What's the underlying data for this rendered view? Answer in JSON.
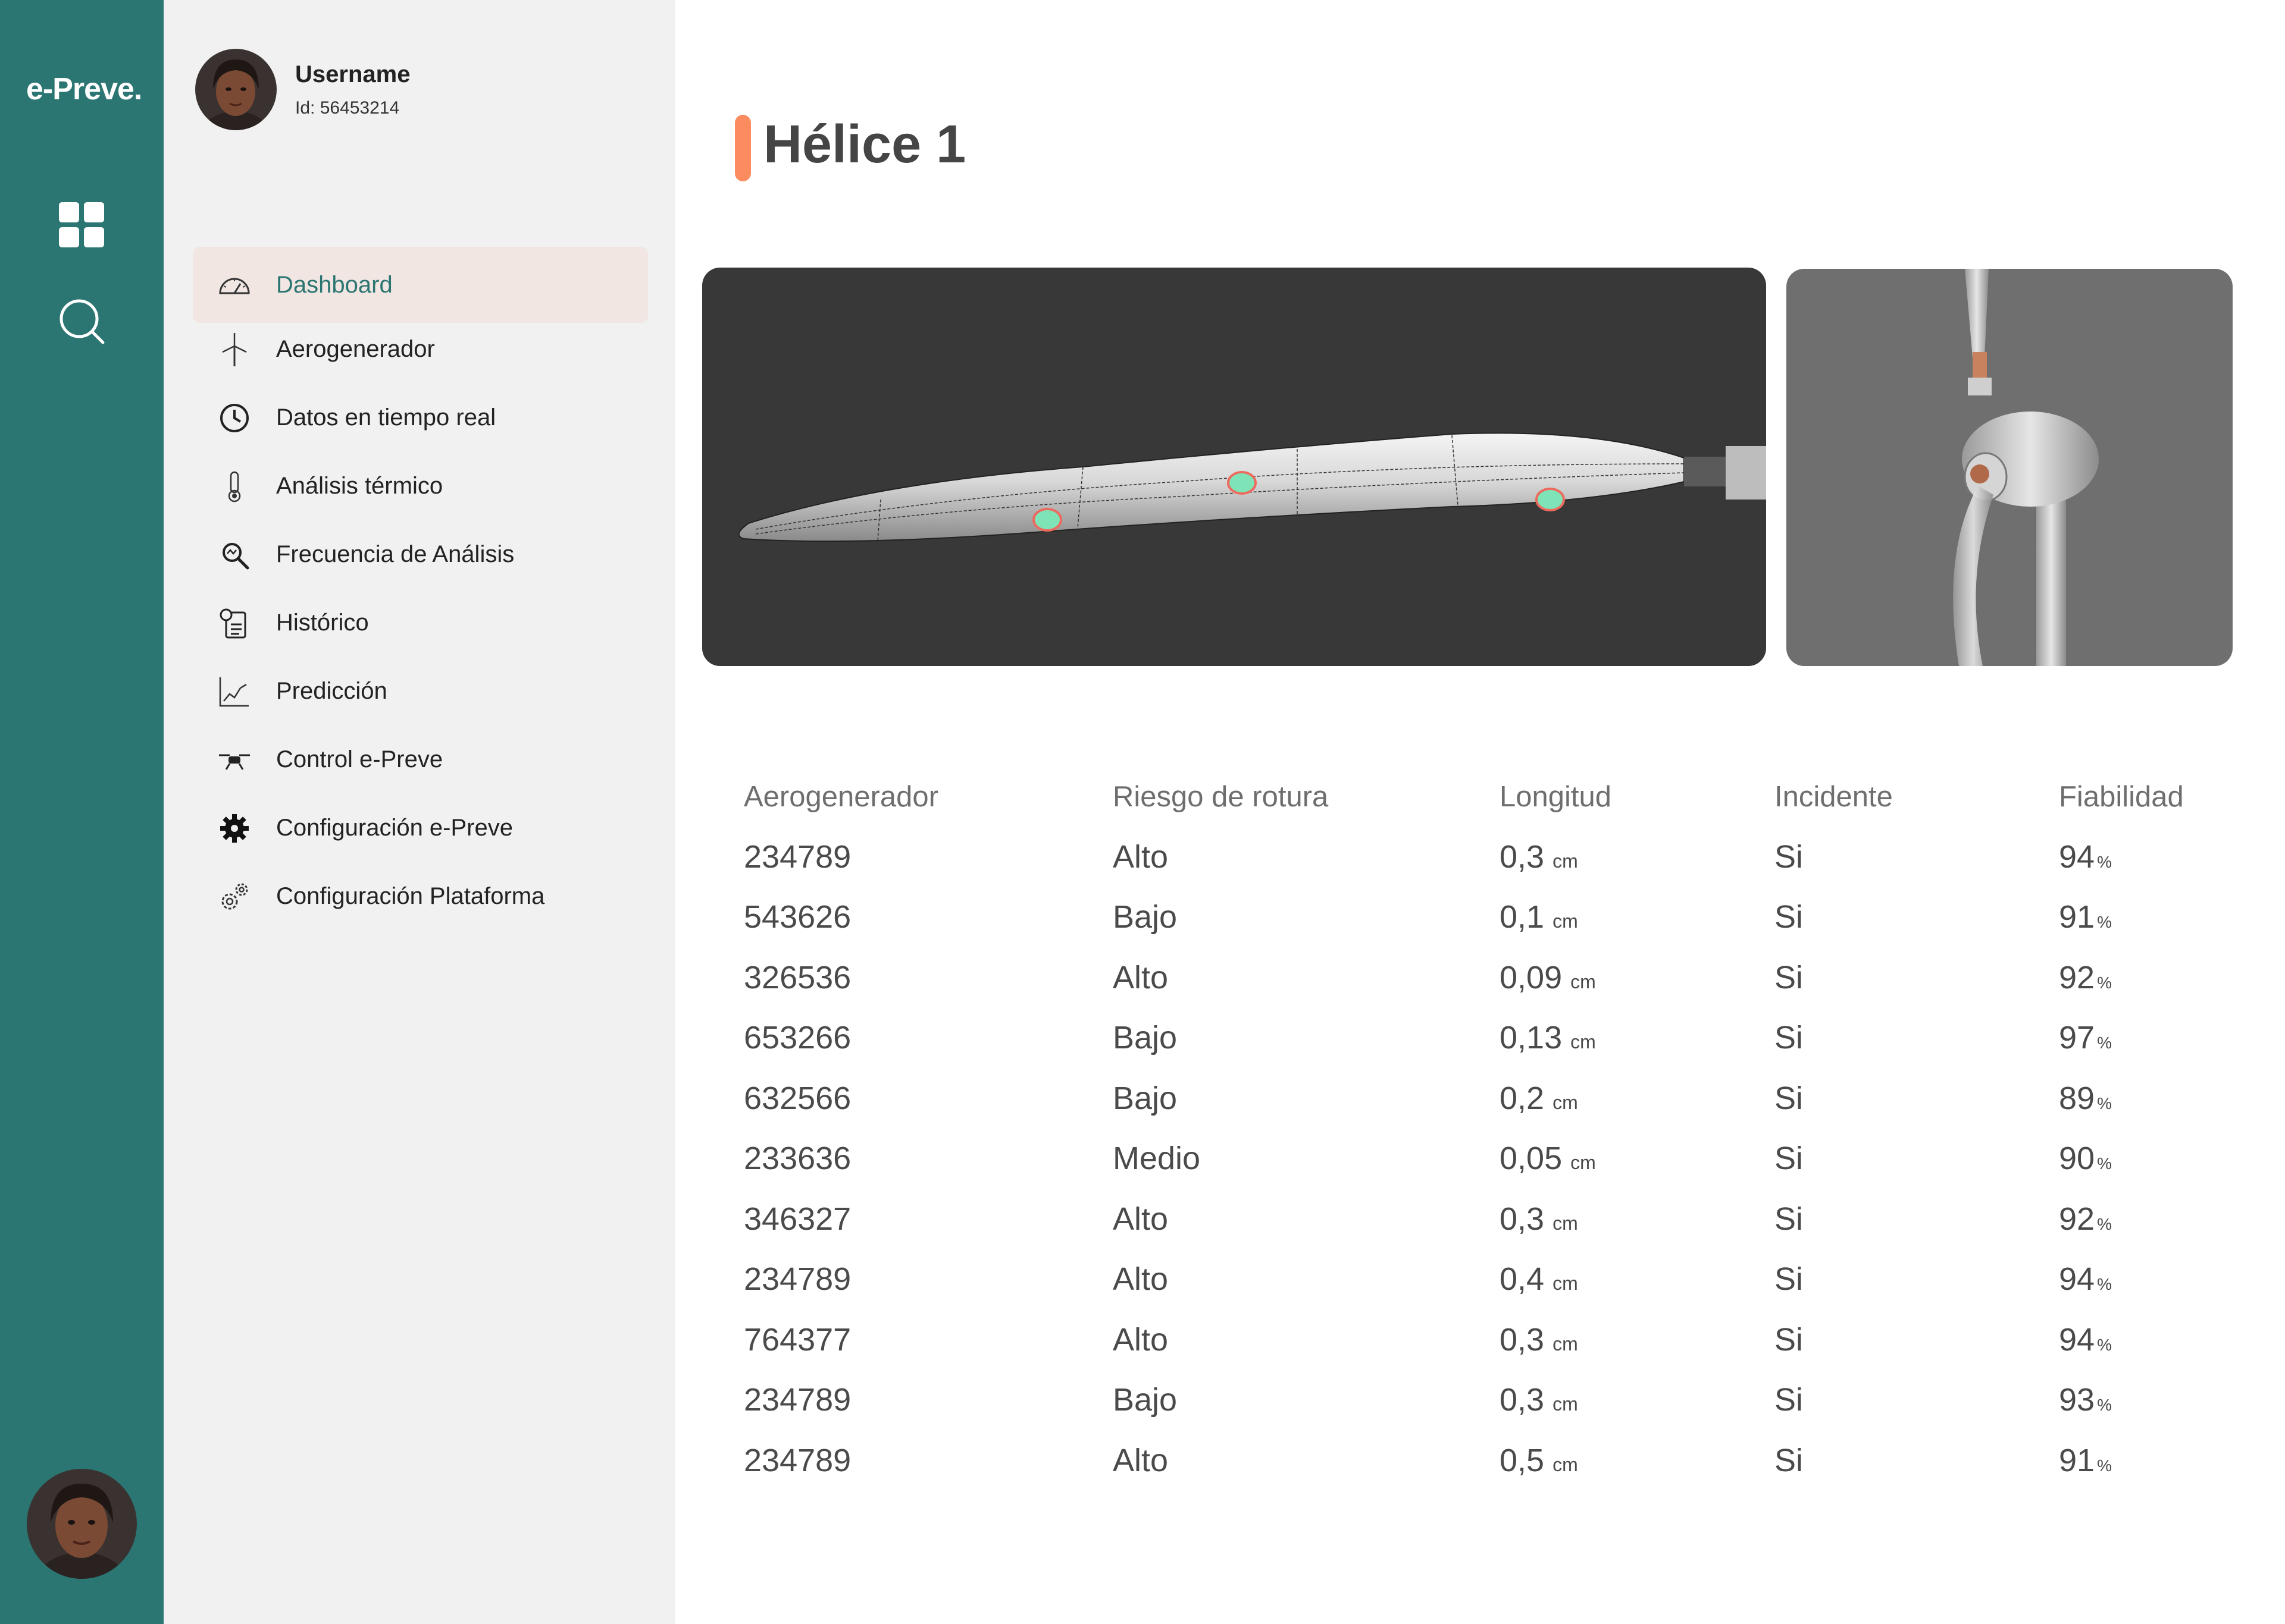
{
  "brand": {
    "logo": "e-Preve."
  },
  "user": {
    "name": "Username",
    "id_label": "Id: 56453214"
  },
  "nav": {
    "items": [
      {
        "label": "Dashboard",
        "icon": "gauge-icon",
        "active": true
      },
      {
        "label": "Aerogenerador",
        "icon": "wind-turbine-icon"
      },
      {
        "label": "Datos en tiempo real",
        "icon": "clock-icon"
      },
      {
        "label": "Análisis térmico",
        "icon": "thermometer-icon"
      },
      {
        "label": "Frecuencia de Análisis",
        "icon": "magnifier-icon"
      },
      {
        "label": "Histórico",
        "icon": "history-document-icon"
      },
      {
        "label": "Predicción",
        "icon": "trend-chart-icon"
      },
      {
        "label": "Control e-Preve",
        "icon": "drone-icon"
      },
      {
        "label": "Configuración e-Preve",
        "icon": "gear-icon"
      },
      {
        "label": "Configuración Plataforma",
        "icon": "gears-icon"
      }
    ]
  },
  "page": {
    "title": "Hélice 1"
  },
  "colors": {
    "rail": "#2b7572",
    "accent": "#fc8c5f",
    "panel": "#f1f1f1",
    "active_bg": "#f1e6e1",
    "marker": "#7fe3b8"
  },
  "table": {
    "headers": [
      "Aerogenerador",
      "Riesgo de rotura",
      "Longitud",
      "Incidente",
      "Fiabilidad"
    ],
    "rows": [
      {
        "id": "234789",
        "risk": "Alto",
        "length": "0,3",
        "length_unit": "cm",
        "incident": "Si",
        "reliability": "94",
        "pct": "%"
      },
      {
        "id": "543626",
        "risk": "Bajo",
        "length": "0,1",
        "length_unit": "cm",
        "incident": "Si",
        "reliability": "91",
        "pct": "%"
      },
      {
        "id": "326536",
        "risk": "Alto",
        "length": "0,09",
        "length_unit": "cm",
        "incident": "Si",
        "reliability": "92",
        "pct": "%"
      },
      {
        "id": "653266",
        "risk": "Bajo",
        "length": "0,13",
        "length_unit": "cm",
        "incident": "Si",
        "reliability": "97",
        "pct": "%"
      },
      {
        "id": "632566",
        "risk": "Bajo",
        "length": "0,2",
        "length_unit": "cm",
        "incident": "Si",
        "reliability": "89",
        "pct": "%"
      },
      {
        "id": "233636",
        "risk": "Medio",
        "length": "0,05",
        "length_unit": "cm",
        "incident": "Si",
        "reliability": "90",
        "pct": "%"
      },
      {
        "id": "346327",
        "risk": "Alto",
        "length": "0,3",
        "length_unit": "cm",
        "incident": "Si",
        "reliability": "92",
        "pct": "%"
      },
      {
        "id": "234789",
        "risk": "Alto",
        "length": "0,4",
        "length_unit": "cm",
        "incident": "Si",
        "reliability": "94",
        "pct": "%"
      },
      {
        "id": "764377",
        "risk": "Alto",
        "length": "0,3",
        "length_unit": "cm",
        "incident": "Si",
        "reliability": "94",
        "pct": "%"
      },
      {
        "id": "234789",
        "risk": "Bajo",
        "length": "0,3",
        "length_unit": "cm",
        "incident": "Si",
        "reliability": "93",
        "pct": "%"
      },
      {
        "id": "234789",
        "risk": "Alto",
        "length": "0,5",
        "length_unit": "cm",
        "incident": "Si",
        "reliability": "91",
        "pct": "%"
      }
    ]
  }
}
